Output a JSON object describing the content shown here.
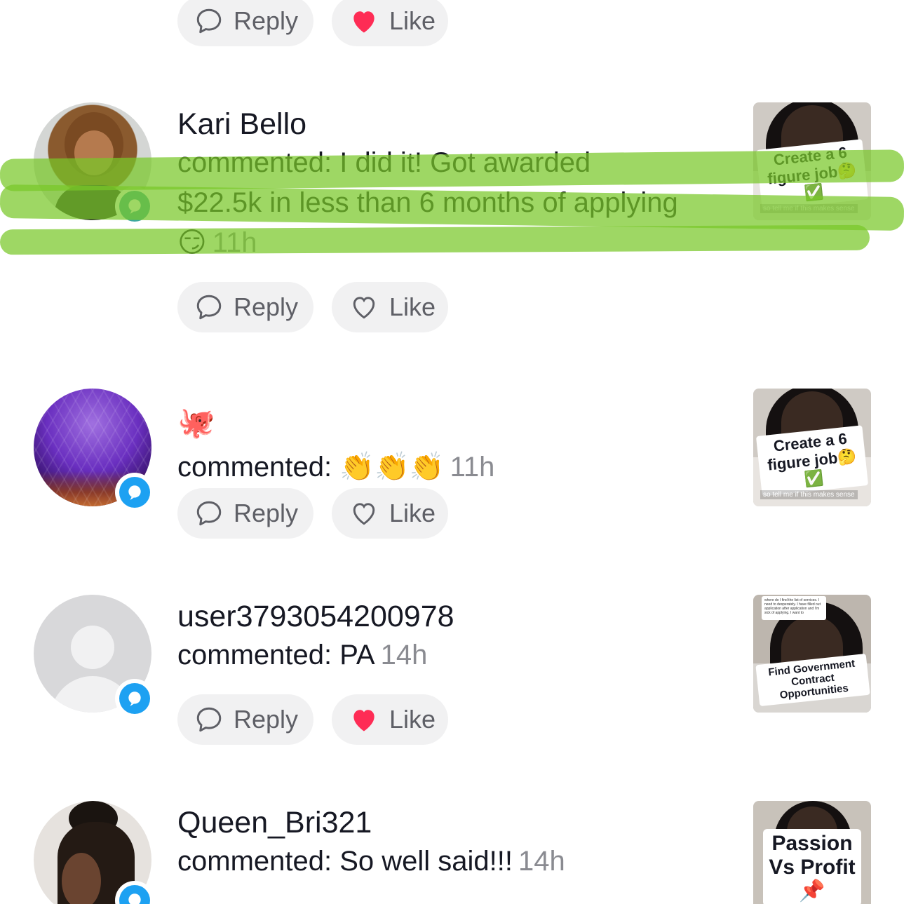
{
  "actions": {
    "reply": "Reply",
    "like": "Like"
  },
  "colors": {
    "like_active": "#fe2c55",
    "badge": "#1da1f2",
    "badge_green": "#3aa7a0",
    "highlight": "#7ac828"
  },
  "top_partial": {
    "liked": true
  },
  "comments": [
    {
      "username": "Kari Bello",
      "text": "commented: I did it! Got awarded $22.5k in less than 6 months of applying",
      "emoji": "😏",
      "time": "11h",
      "liked": false,
      "avatar_icon": "curly-hair-woman-avatar",
      "thumb_caption": "Create a 6 figure job🤔✅",
      "thumb_small": "so tell me if this makes sense"
    },
    {
      "username": "🐙",
      "text": "commented:",
      "emoji": "👏👏👏",
      "time": "11h",
      "liked": false,
      "avatar_icon": "purple-geodesic-sphere-avatar",
      "thumb_caption": "Create a 6 figure job🤔✅",
      "thumb_small": "so tell me if this makes sense"
    },
    {
      "username": "user3793054200978",
      "text": "commented: PA",
      "emoji": "",
      "time": "14h",
      "liked": true,
      "avatar_icon": "default-user-avatar",
      "thumb_caption": "Find Government Contract Opportunities",
      "thumb_note": "where do I find the list of services. I need to desperately. I have filled out application after application and I'm sick of applying. I want to"
    },
    {
      "username": "Queen_Bri321",
      "text": "commented: So well said!!!",
      "emoji": "",
      "time": "14h",
      "liked": false,
      "avatar_icon": "woman-braids-avatar",
      "thumb_caption": "Passion Vs Profit 📌"
    }
  ]
}
